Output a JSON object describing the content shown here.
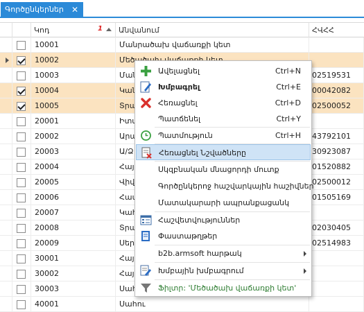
{
  "tab": {
    "title": "Գործընկերներ",
    "close": "✕"
  },
  "grid": {
    "columns": {
      "code": "Կոդ",
      "name": "Անվանում",
      "tax": "ՀՎՀՀ"
    },
    "sort_index": "1",
    "rows": [
      {
        "code": "10001",
        "name": "Մանրածախ վաճառքի կետ",
        "tax": "",
        "checked": false,
        "selected": false
      },
      {
        "code": "10002",
        "name": "Մեծածախ վաճառքի կետ",
        "tax": "",
        "checked": true,
        "selected": true
      },
      {
        "code": "10003",
        "name": "Մանրածախ",
        "tax": "02519531",
        "checked": false,
        "selected": false
      },
      {
        "code": "10004",
        "name": "Կանչ",
        "tax": "00042082",
        "checked": true,
        "selected": true
      },
      {
        "code": "10005",
        "name": "Տրամ",
        "tax": "02500052",
        "checked": true,
        "selected": true
      },
      {
        "code": "20001",
        "name": "Իտալ",
        "tax": "",
        "checked": false,
        "selected": false
      },
      {
        "code": "20002",
        "name": "Արամ",
        "tax": "43792101",
        "checked": false,
        "selected": false
      },
      {
        "code": "20003",
        "name": "Ա/Ձ",
        "tax": "30923087",
        "checked": false,
        "selected": false
      },
      {
        "code": "20004",
        "name": "Հայա",
        "tax": "01520882",
        "checked": false,
        "selected": false
      },
      {
        "code": "20005",
        "name": "Վիվա",
        "tax": "02500012",
        "checked": false,
        "selected": false
      },
      {
        "code": "20006",
        "name": "Համա",
        "tax": "01505169",
        "checked": false,
        "selected": false
      },
      {
        "code": "20007",
        "name": "Կահու",
        "tax": "",
        "checked": false,
        "selected": false
      },
      {
        "code": "20008",
        "name": "Տրամ",
        "tax": "02030405",
        "checked": false,
        "selected": false
      },
      {
        "code": "20009",
        "name": "Սերվ",
        "tax": "02514983",
        "checked": false,
        "selected": false
      },
      {
        "code": "30001",
        "name": "Հայր",
        "tax": "",
        "checked": false,
        "selected": false
      },
      {
        "code": "30002",
        "name": "Հայր",
        "tax": "",
        "checked": false,
        "selected": false
      },
      {
        "code": "30003",
        "name": "Սահու",
        "tax": "",
        "checked": false,
        "selected": false
      },
      {
        "code": "40001",
        "name": "Սահու",
        "tax": "",
        "checked": false,
        "selected": false
      }
    ]
  },
  "context_menu": {
    "items": [
      {
        "label": "Ավելացնել",
        "shortcut": "Ctrl+N",
        "icon": "plus-icon"
      },
      {
        "label": "Խմբագրել",
        "shortcut": "Ctrl+E",
        "icon": "edit-icon"
      },
      {
        "label": "Հեռացնել",
        "shortcut": "Ctrl+D",
        "icon": "delete-icon"
      },
      {
        "label": "Պատճենել",
        "shortcut": "Ctrl+Y",
        "icon": "copy-icon"
      },
      {
        "label": "Պատմություն",
        "shortcut": "Ctrl+H",
        "icon": "history-icon"
      },
      {
        "label": "Հեռացնել Նշվածները",
        "shortcut": "",
        "icon": "delete-marked-icon"
      },
      {
        "label": "Սկզբնական մնացորդի մուտք",
        "shortcut": "",
        "icon": ""
      },
      {
        "label": "Գործընկերոջ հաշվարկային հաշիվներ",
        "shortcut": "",
        "icon": ""
      },
      {
        "label": "Մատակարարի ապրանքացանկ",
        "shortcut": "",
        "icon": ""
      },
      {
        "label": "Հաշվետվություններ",
        "shortcut": "",
        "icon": "reports-icon"
      },
      {
        "label": "Փաստաթղթեր",
        "shortcut": "",
        "icon": "documents-icon"
      },
      {
        "label": "b2b.armsoft հարթակ",
        "shortcut": "",
        "icon": ""
      },
      {
        "label": "Խմբային խմբագրում",
        "shortcut": "",
        "icon": "group-edit-icon"
      },
      {
        "label": "Ֆիլտր: 'Մեծածախ վաճառքի կետ'",
        "shortcut": "",
        "icon": "filter-icon"
      }
    ]
  },
  "colors": {
    "accent": "#2b8ad8",
    "selected_row": "#fbe3c0",
    "menu_highlight": "#cfe3f6",
    "filter_text": "#2e7d32"
  }
}
